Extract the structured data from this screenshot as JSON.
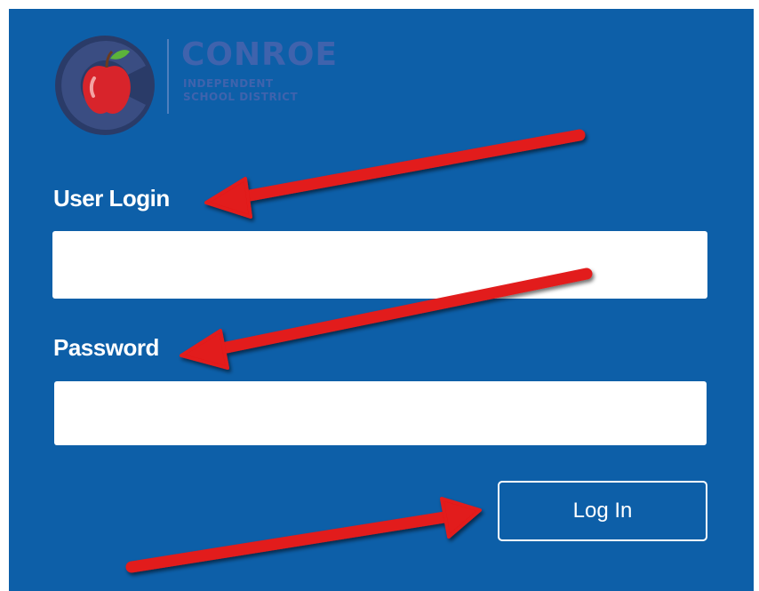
{
  "brand": {
    "name": "CONROE",
    "sub_line1": "INDEPENDENT",
    "sub_line2": "SCHOOL DISTRICT",
    "logo_icon": "apple-c-logo"
  },
  "form": {
    "user_label": "User Login",
    "user_value": "",
    "password_label": "Password",
    "password_value": "",
    "login_button_label": "Log In"
  },
  "annotations": {
    "arrow_color": "#e21a1a",
    "arrow_count": 3
  },
  "colors": {
    "panel_background": "#0d5fa8",
    "brand_text": "#3f63ad",
    "logo_circle": "#2a3b68",
    "apple_red": "#d8242b",
    "leaf_green": "#5cb33a"
  }
}
